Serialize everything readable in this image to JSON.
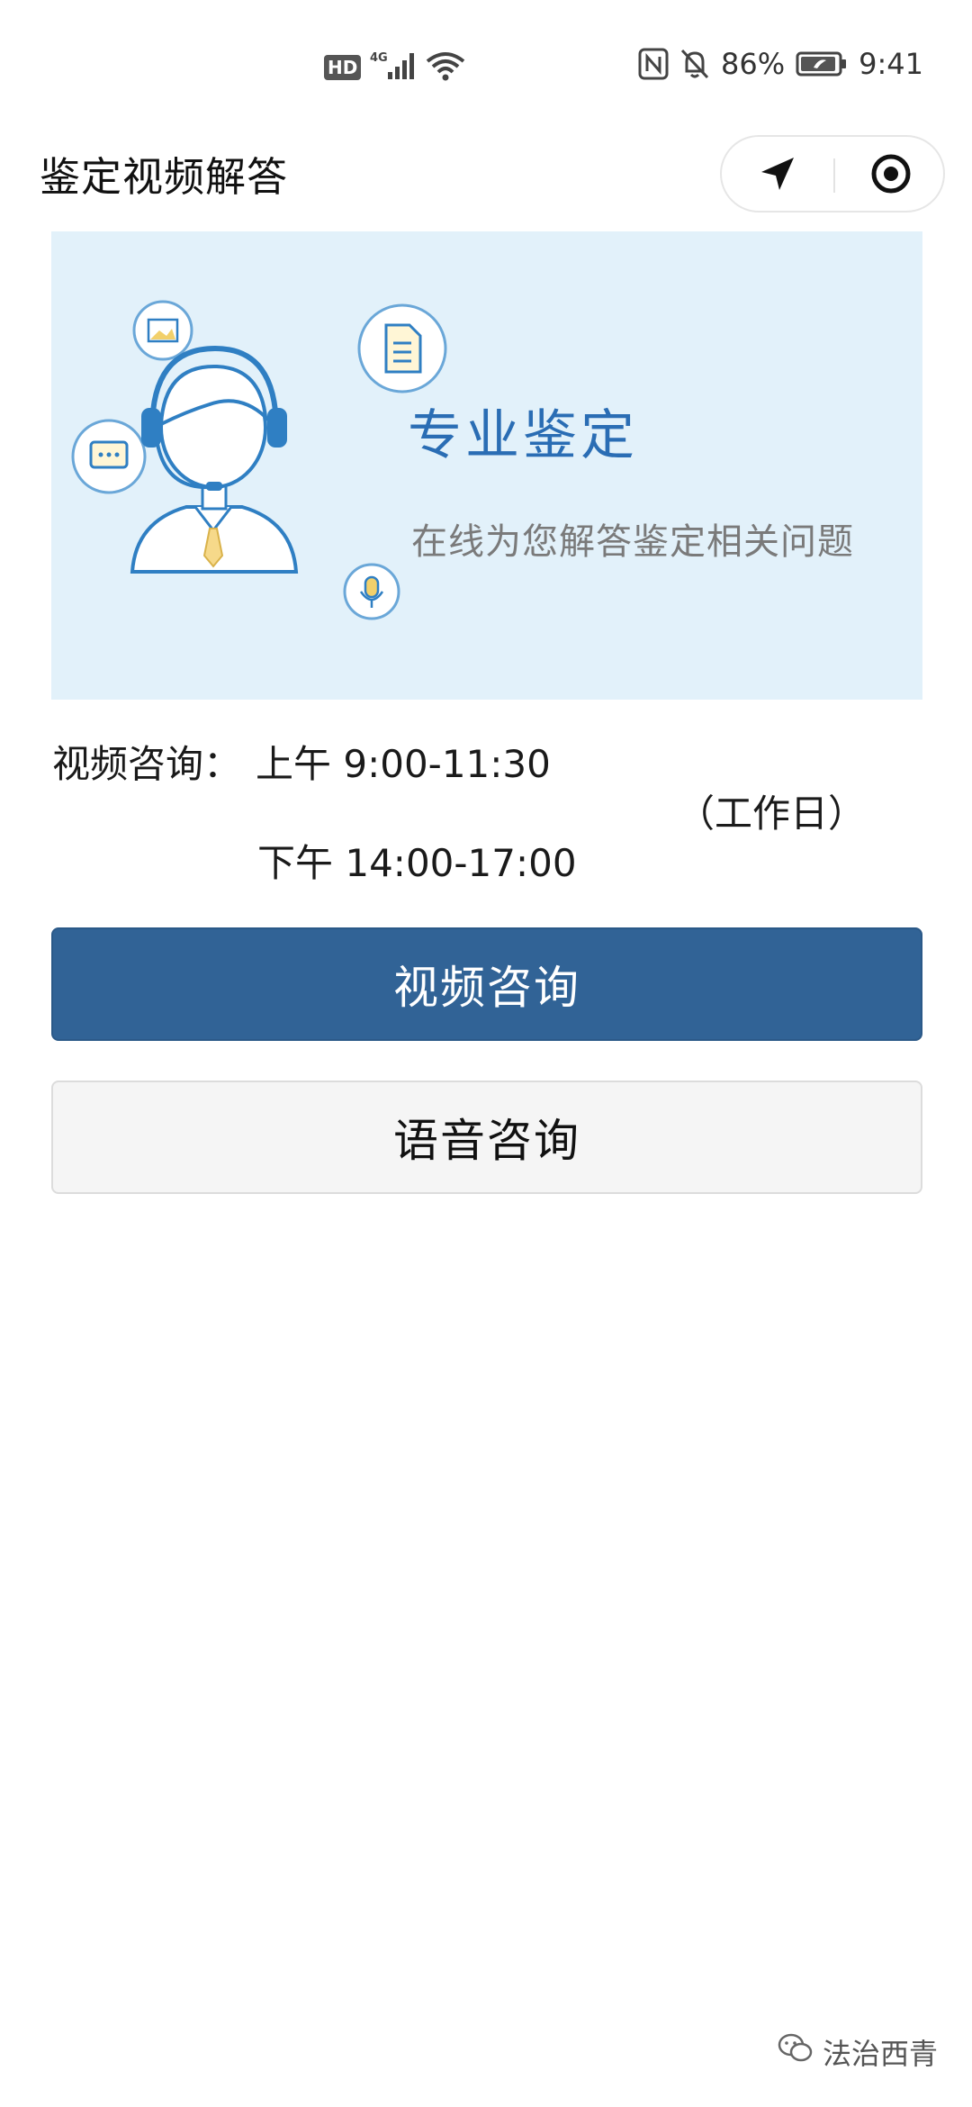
{
  "status_bar": {
    "hd": "HD",
    "network": "4G",
    "battery_percent": "86%",
    "time": "9:41"
  },
  "header": {
    "title": "鉴定视频解答",
    "capsule_icons": [
      "navigation-arrow-icon",
      "target-circle-icon"
    ]
  },
  "banner": {
    "title": "专业鉴定",
    "subtitle": "在线为您解答鉴定相关问题",
    "background": "#e2f1fa",
    "accent": "#2a6db4"
  },
  "hours": {
    "label": "视频咨询：",
    "morning": "上午 9:00-11:30",
    "afternoon": "下午 14:00-17:00",
    "weekday": "（工作日）"
  },
  "buttons": {
    "video": "视频咨询",
    "voice": "语音咨询",
    "video_color": "#316396"
  },
  "watermark": {
    "text": "法治西青"
  }
}
